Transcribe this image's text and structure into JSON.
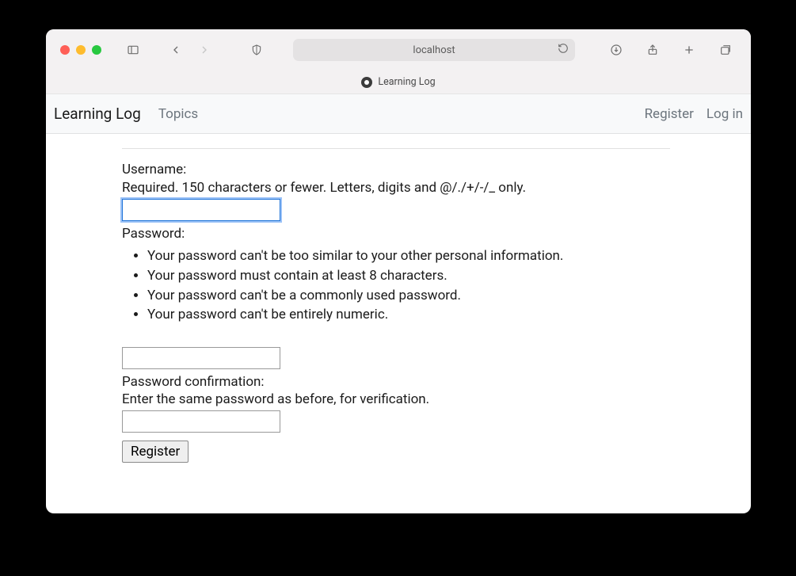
{
  "browser": {
    "url_display": "localhost",
    "tab_title": "Learning Log"
  },
  "appbar": {
    "brand": "Learning Log",
    "topics": "Topics",
    "register": "Register",
    "login": "Log in"
  },
  "form": {
    "username_label": "Username:",
    "username_help": "Required. 150 characters or fewer. Letters, digits and @/./+/-/_ only.",
    "password_label": "Password:",
    "password_rules": [
      "Your password can't be too similar to your other personal information.",
      "Your password must contain at least 8 characters.",
      "Your password can't be a commonly used password.",
      "Your password can't be entirely numeric."
    ],
    "password2_label": "Password confirmation:",
    "password2_help": "Enter the same password as before, for verification.",
    "submit_label": "Register"
  }
}
